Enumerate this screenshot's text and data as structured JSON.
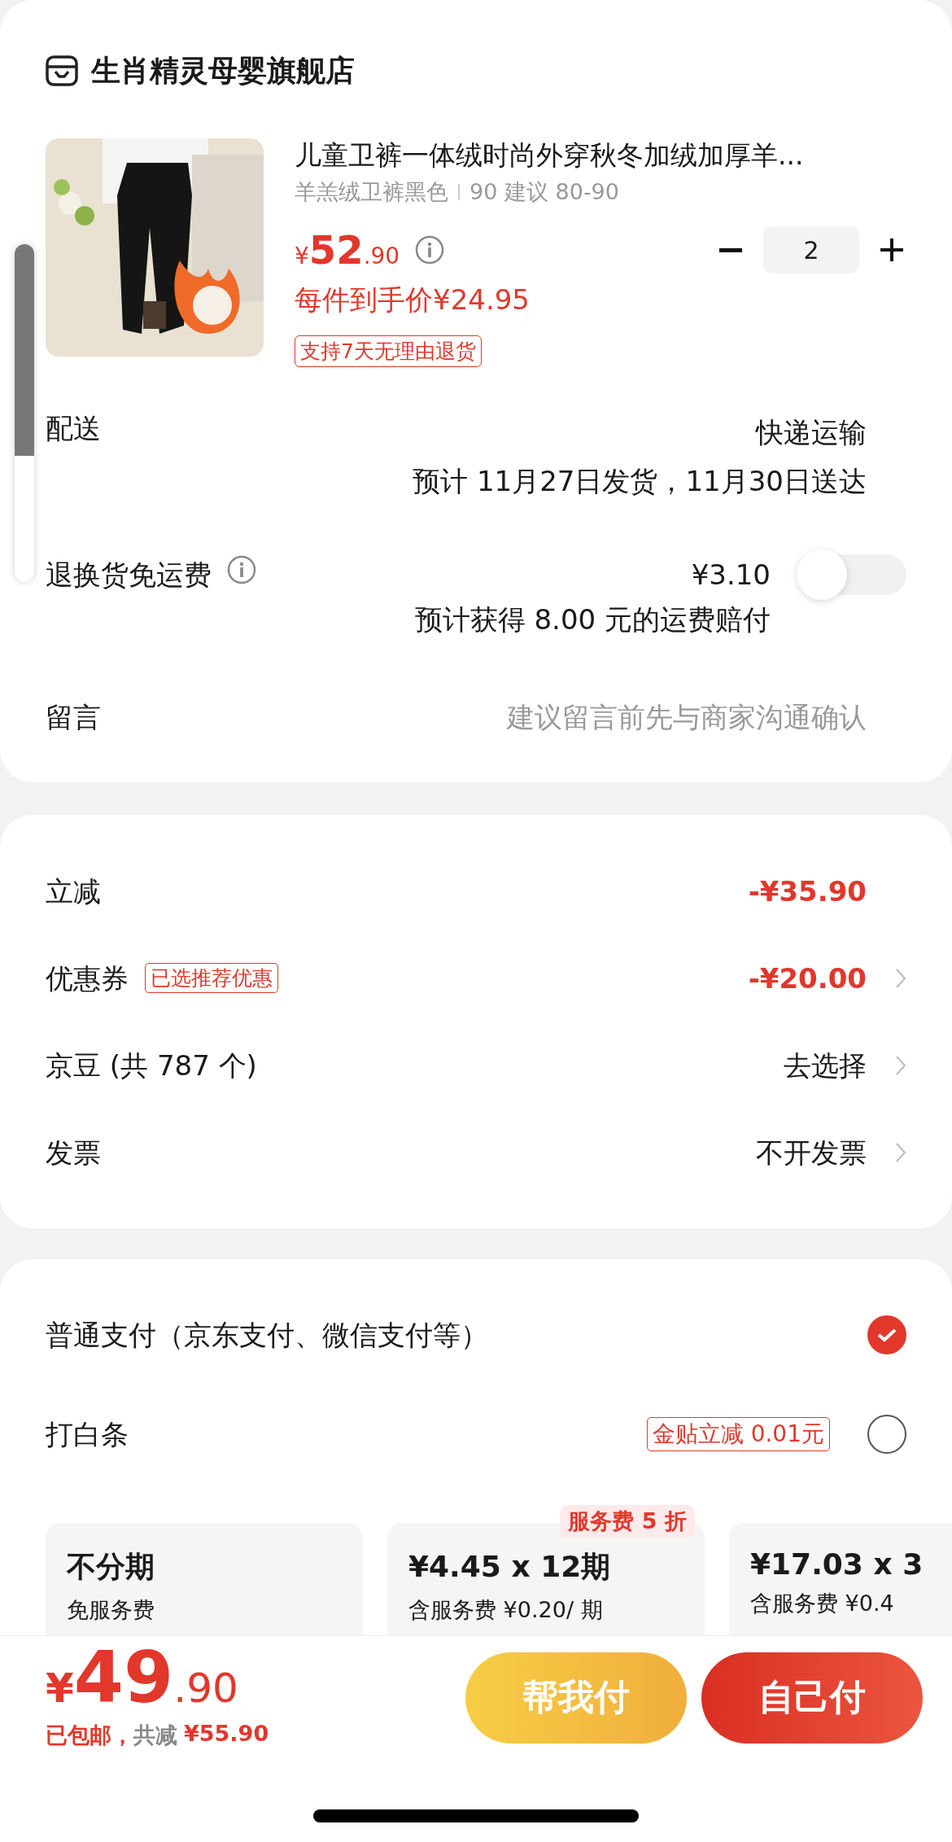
{
  "store": {
    "name": "生肖精灵母婴旗舰店"
  },
  "product": {
    "title": "儿童卫裤一体绒时尚外穿秋冬加绒加厚羊...",
    "spec": "羊羔绒卫裤黑色",
    "size": "90 建议 80-90",
    "currency": "¥",
    "price_int": "52",
    "price_dec": ".90",
    "quantity": "2",
    "per_item_price": "每件到手价¥24.95",
    "return_tag": "支持7天无理由退货"
  },
  "delivery": {
    "label": "配送",
    "method": "快递运输",
    "estimate": "预计 11月27日发货，11月30日送达"
  },
  "return_insurance": {
    "label": "退换货免运费",
    "price": "¥3.10",
    "note": "预计获得 8.00 元的运费赔付",
    "on": false
  },
  "message": {
    "label": "留言",
    "placeholder": "建议留言前先与商家沟通确认"
  },
  "discounts": [
    {
      "label": "立减",
      "value": "-¥35.90",
      "red": true,
      "chevron": false
    },
    {
      "label": "优惠券",
      "tag": "已选推荐优惠",
      "value": "-¥20.00",
      "red": true,
      "chevron": true
    },
    {
      "label": "京豆 (共 787 个)",
      "value": "去选择",
      "red": false,
      "chevron": true
    },
    {
      "label": "发票",
      "value": "不开发票",
      "red": false,
      "chevron": true
    }
  ],
  "payment_methods": [
    {
      "label": "普通支付（京东支付、微信支付等）",
      "selected": true
    },
    {
      "label": "打白条",
      "tag": "金贴立减 0.01元",
      "selected": false
    }
  ],
  "installments": [
    {
      "title": "不分期",
      "note": "免服务费"
    },
    {
      "title": "¥4.45 x 12期",
      "note": "含服务费 ¥0.20/ 期",
      "badge": "服务费 5 折"
    },
    {
      "title": "¥17.03 x 3",
      "note": "含服务费 ¥0.4"
    }
  ],
  "footer": {
    "currency": "¥",
    "total_int": "49",
    "total_dec": ".90",
    "shipping": "已包邮，",
    "saved_label": "共减",
    "saved_amount": "¥55.90",
    "buttons": [
      {
        "label": "帮我付",
        "kind": "friend"
      },
      {
        "label": "自己付",
        "kind": "self"
      }
    ]
  }
}
